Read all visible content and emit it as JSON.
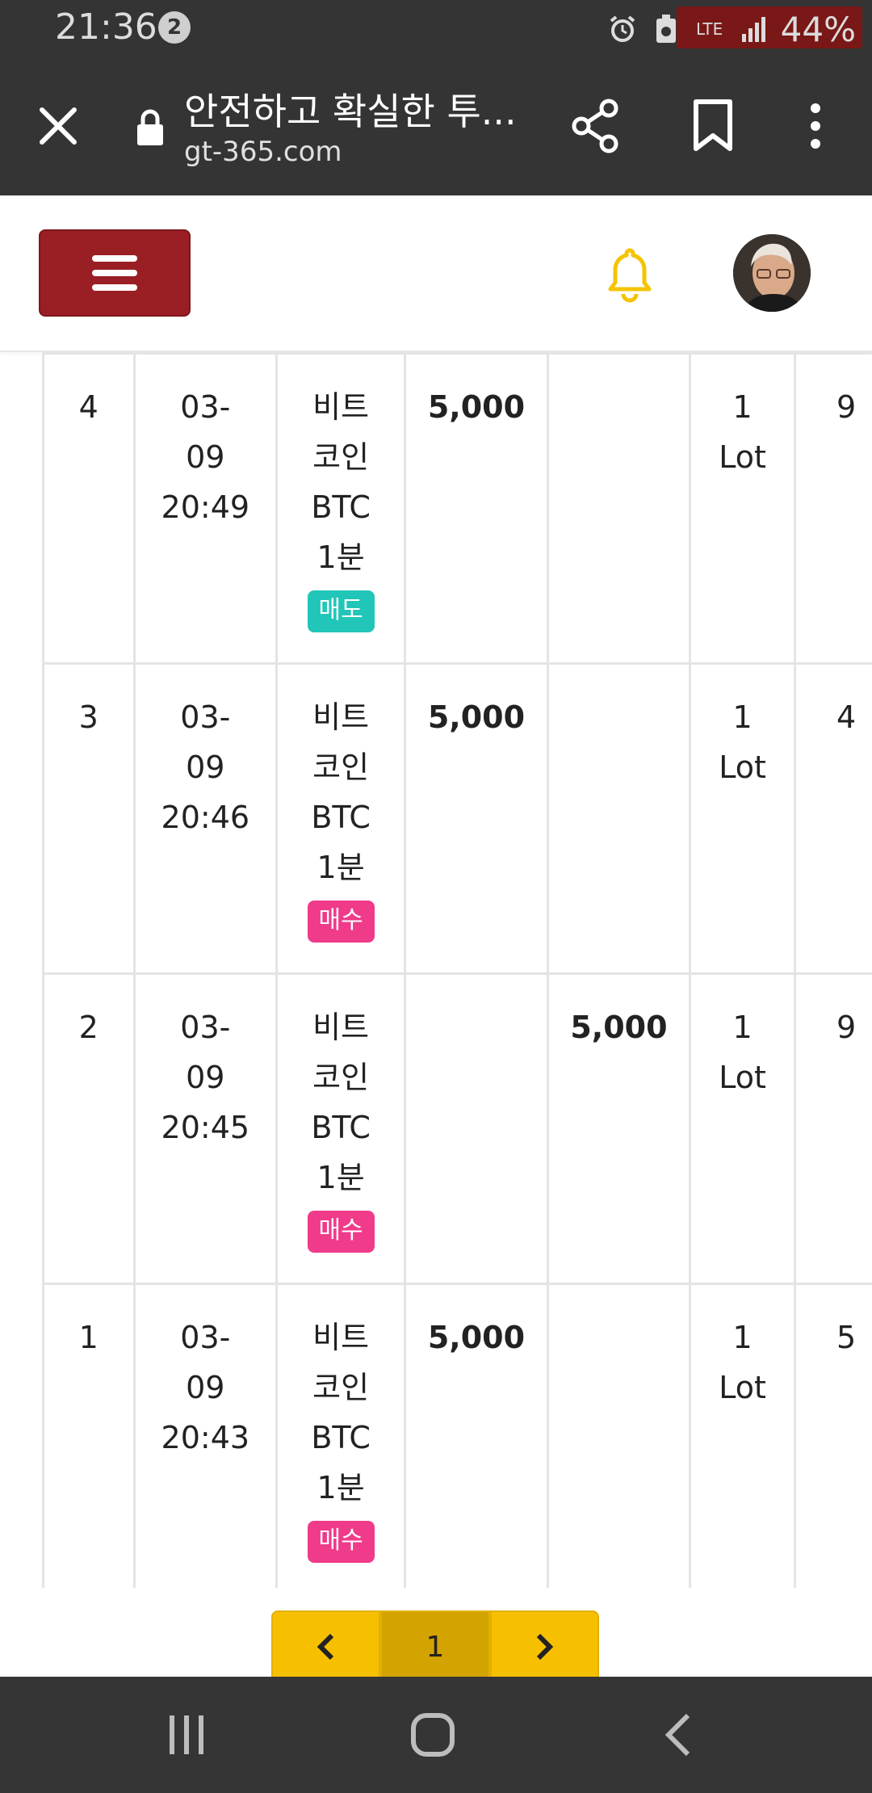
{
  "status_bar": {
    "time": "21:36",
    "notification_count": "2",
    "network": "LTE",
    "battery": "44%"
  },
  "browser": {
    "title": "안전하고 확실한 투...",
    "url": "gt-365.com"
  },
  "rows": [
    {
      "no": "4",
      "date": "03-",
      "date2": "09",
      "time": "20:49",
      "item1": "비트",
      "item2": "코인",
      "item3": "BTC",
      "item4": "1분",
      "badge": "매도",
      "win": "5,000",
      "lose": "",
      "lot1": "1",
      "lot2": "Lot",
      "extra": "9"
    },
    {
      "no": "3",
      "date": "03-",
      "date2": "09",
      "time": "20:46",
      "item1": "비트",
      "item2": "코인",
      "item3": "BTC",
      "item4": "1분",
      "badge": "매수",
      "win": "5,000",
      "lose": "",
      "lot1": "1",
      "lot2": "Lot",
      "extra": "4"
    },
    {
      "no": "2",
      "date": "03-",
      "date2": "09",
      "time": "20:45",
      "item1": "비트",
      "item2": "코인",
      "item3": "BTC",
      "item4": "1분",
      "badge": "매수",
      "win": "",
      "lose": "5,000",
      "lot1": "1",
      "lot2": "Lot",
      "extra": "9"
    },
    {
      "no": "1",
      "date": "03-",
      "date2": "09",
      "time": "20:43",
      "item1": "비트",
      "item2": "코인",
      "item3": "BTC",
      "item4": "1분",
      "badge": "매수",
      "win": "5,000",
      "lose": "",
      "lot1": "1",
      "lot2": "Lot",
      "extra": "5"
    }
  ],
  "pagination": {
    "prev": "‹",
    "current": "1",
    "next": "›"
  },
  "colors": {
    "menu_button": "#9a1f24",
    "bell": "#f5c400",
    "sell_badge": "#22c6b8",
    "buy_badge": "#f03a8a",
    "win_value": "#5bb6ac",
    "lose_value": "#b5252b",
    "pager": "#f6c000"
  }
}
